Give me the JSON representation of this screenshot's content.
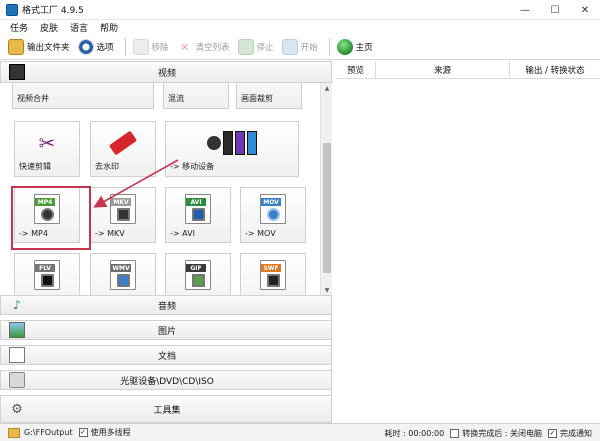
{
  "window": {
    "title": "格式工厂 4.9.5",
    "controls": {
      "minimize": "—",
      "maximize": "☐",
      "close": "✕"
    }
  },
  "menu": [
    "任务",
    "皮肤",
    "语言",
    "帮助"
  ],
  "toolbar": {
    "output_folder": "输出文件夹",
    "options": "选项",
    "remove": "移除",
    "clear_list": "清空列表",
    "stop": "停止",
    "start": "开始",
    "home": "主页"
  },
  "categories": {
    "video": "视频",
    "audio": "音频",
    "image": "图片",
    "document": "文档",
    "disc": "光驱设备\\DVD\\CD\\ISO",
    "tools": "工具集"
  },
  "tiles": {
    "video_merge": "视频合并",
    "mix": "混流",
    "crop": "画面裁剪",
    "quick_clip": "快速剪辑",
    "watermark": "去水印",
    "mobile": "-> 移动设备",
    "mp4": "-> MP4",
    "mkv": "-> MKV",
    "avi": "-> AVI",
    "mov": "-> MOV",
    "badges": {
      "mp4": "MP4",
      "mkv": "MKV",
      "avi": "AVI",
      "mov": "MOV",
      "flv": "FLV",
      "wmv": "WMV",
      "gif": "GIF",
      "swf": "SWF"
    }
  },
  "table": {
    "headers": [
      "预览",
      "来源",
      "输出 / 转换状态"
    ]
  },
  "status": {
    "path": "G:\\FFOutput",
    "multithread": "使用多线程",
    "elapsed": "耗时 : 00:00:00",
    "after_convert": "转换完成后 : 关闭电脑",
    "notify": "完成通知"
  },
  "colors": {
    "highlight": "#c8344b",
    "mp4": "#4c9c3c",
    "mkv": "#9a9a9a",
    "avi": "#2e8c3a",
    "mov": "#3a7fc8",
    "wmv": "#6b6b6b",
    "gif": "#3a3a3a",
    "swf": "#e07a1f"
  }
}
